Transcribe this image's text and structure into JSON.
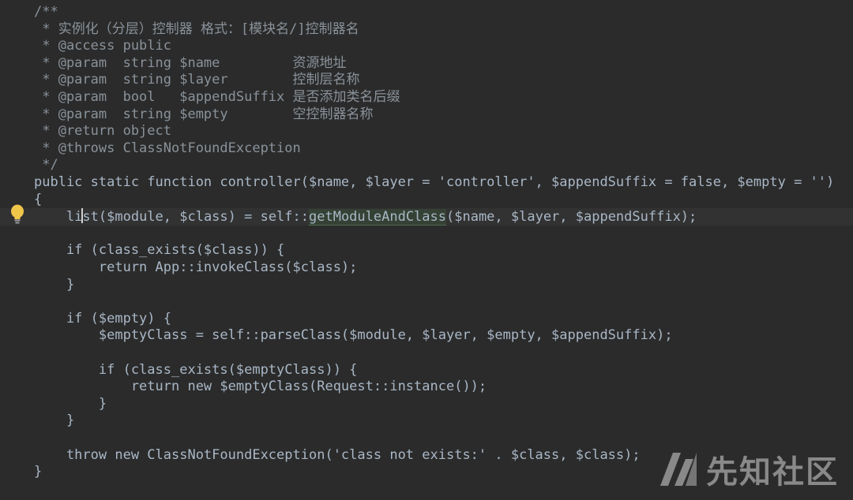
{
  "editor": {
    "lines": [
      {
        "segments": [
          {
            "t": "/**",
            "k": "comment"
          }
        ]
      },
      {
        "segments": [
          {
            "t": " * 实例化（分层）控制器 格式：[模块名/]控制器名",
            "k": "comment"
          }
        ]
      },
      {
        "segments": [
          {
            "t": " * @access public",
            "k": "comment"
          }
        ]
      },
      {
        "segments": [
          {
            "t": " * @param  string $name         资源地址",
            "k": "comment"
          }
        ]
      },
      {
        "segments": [
          {
            "t": " * @param  string $layer        控制层名称",
            "k": "comment"
          }
        ]
      },
      {
        "segments": [
          {
            "t": " * @param  bool   $appendSuffix 是否添加类名后缀",
            "k": "comment"
          }
        ]
      },
      {
        "segments": [
          {
            "t": " * @param  string $empty        空控制器名称",
            "k": "comment"
          }
        ]
      },
      {
        "segments": [
          {
            "t": " * @return object",
            "k": "comment"
          }
        ]
      },
      {
        "segments": [
          {
            "t": " * @throws ClassNotFoundException",
            "k": "comment"
          }
        ]
      },
      {
        "segments": [
          {
            "t": " */",
            "k": "comment"
          }
        ]
      },
      {
        "segments": [
          {
            "t": "public static function controller($name, $layer = 'controller', $appendSuffix = false, $empty = '')",
            "k": "plain"
          }
        ]
      },
      {
        "segments": [
          {
            "t": "{",
            "k": "plain"
          }
        ]
      },
      {
        "current": true,
        "segments": [
          {
            "t": "    li",
            "k": "plain"
          },
          {
            "t": "",
            "k": "caret"
          },
          {
            "t": "st($module, $class) = self::",
            "k": "plain"
          },
          {
            "t": "getModuleAndClass",
            "k": "hl"
          },
          {
            "t": "($name, $layer, $appendSuffix);",
            "k": "plain"
          }
        ]
      },
      {
        "segments": [
          {
            "t": "",
            "k": "plain"
          }
        ]
      },
      {
        "segments": [
          {
            "t": "    if (class_exists($class)) {",
            "k": "plain"
          }
        ]
      },
      {
        "segments": [
          {
            "t": "        return App::invokeClass($class);",
            "k": "plain"
          }
        ]
      },
      {
        "segments": [
          {
            "t": "    }",
            "k": "plain"
          }
        ]
      },
      {
        "segments": [
          {
            "t": "",
            "k": "plain"
          }
        ]
      },
      {
        "segments": [
          {
            "t": "    if ($empty) {",
            "k": "plain"
          }
        ]
      },
      {
        "segments": [
          {
            "t": "        $emptyClass = self::parseClass($module, $layer, $empty, $appendSuffix);",
            "k": "plain"
          }
        ]
      },
      {
        "segments": [
          {
            "t": "",
            "k": "plain"
          }
        ]
      },
      {
        "segments": [
          {
            "t": "        if (class_exists($emptyClass)) {",
            "k": "plain"
          }
        ]
      },
      {
        "segments": [
          {
            "t": "            return new $emptyClass(Request::instance());",
            "k": "plain"
          }
        ]
      },
      {
        "segments": [
          {
            "t": "        }",
            "k": "plain"
          }
        ]
      },
      {
        "segments": [
          {
            "t": "    }",
            "k": "plain"
          }
        ]
      },
      {
        "segments": [
          {
            "t": "",
            "k": "plain"
          }
        ]
      },
      {
        "segments": [
          {
            "t": "    throw new ClassNotFoundException('class not exists:' . $class, $class);",
            "k": "plain"
          }
        ]
      },
      {
        "segments": [
          {
            "t": "}",
            "k": "plain"
          }
        ]
      }
    ]
  },
  "gutter": {
    "icon": "lightbulb-icon"
  },
  "watermark": {
    "text": "先知社区",
    "icon": "xianzhi-logo-icon"
  },
  "colors": {
    "background": "#2b2b2b",
    "text": "#a9b7c6",
    "comment": "#8a929a",
    "highlight": "#344134",
    "bulb": "#f0c64a"
  }
}
